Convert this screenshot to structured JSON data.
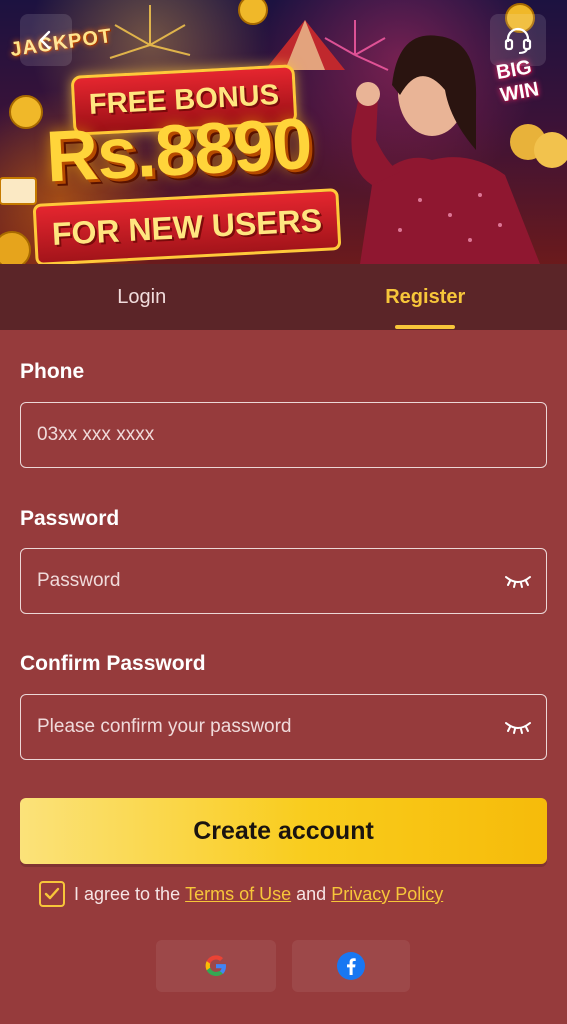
{
  "banner": {
    "jackpot_text": "JACKPOT",
    "bigwin_text": "BIG WIN",
    "promo_line1": "FREE BONUS",
    "promo_amount": "Rs.8890",
    "promo_line3": "FOR NEW USERS"
  },
  "header": {
    "back_icon": "chevron-left-icon",
    "support_icon": "headset-icon"
  },
  "tabs": [
    {
      "label": "Login",
      "active": false
    },
    {
      "label": "Register",
      "active": true
    }
  ],
  "form": {
    "phone": {
      "label": "Phone",
      "placeholder": "03xx xxx xxxx",
      "value": ""
    },
    "password": {
      "label": "Password",
      "placeholder": "Password",
      "value": "",
      "toggle_icon": "eye-closed-icon"
    },
    "confirm_password": {
      "label": "Confirm Password",
      "placeholder": "Please confirm your password",
      "value": "",
      "toggle_icon": "eye-closed-icon"
    },
    "submit_label": "Create account"
  },
  "agreement": {
    "checked": true,
    "prefix": "I agree to the",
    "terms_link": "Terms of Use",
    "and": "and",
    "privacy_link": "Privacy Policy"
  },
  "social": [
    {
      "name": "Google",
      "icon": "google-icon"
    },
    {
      "name": "Facebook",
      "icon": "facebook-icon"
    }
  ],
  "colors": {
    "background": "#963b3c",
    "tab_bar": "#5b2528",
    "accent": "#f7c63a",
    "button_gradient_start": "#fbe27a",
    "button_gradient_end": "#f6bb0a"
  }
}
